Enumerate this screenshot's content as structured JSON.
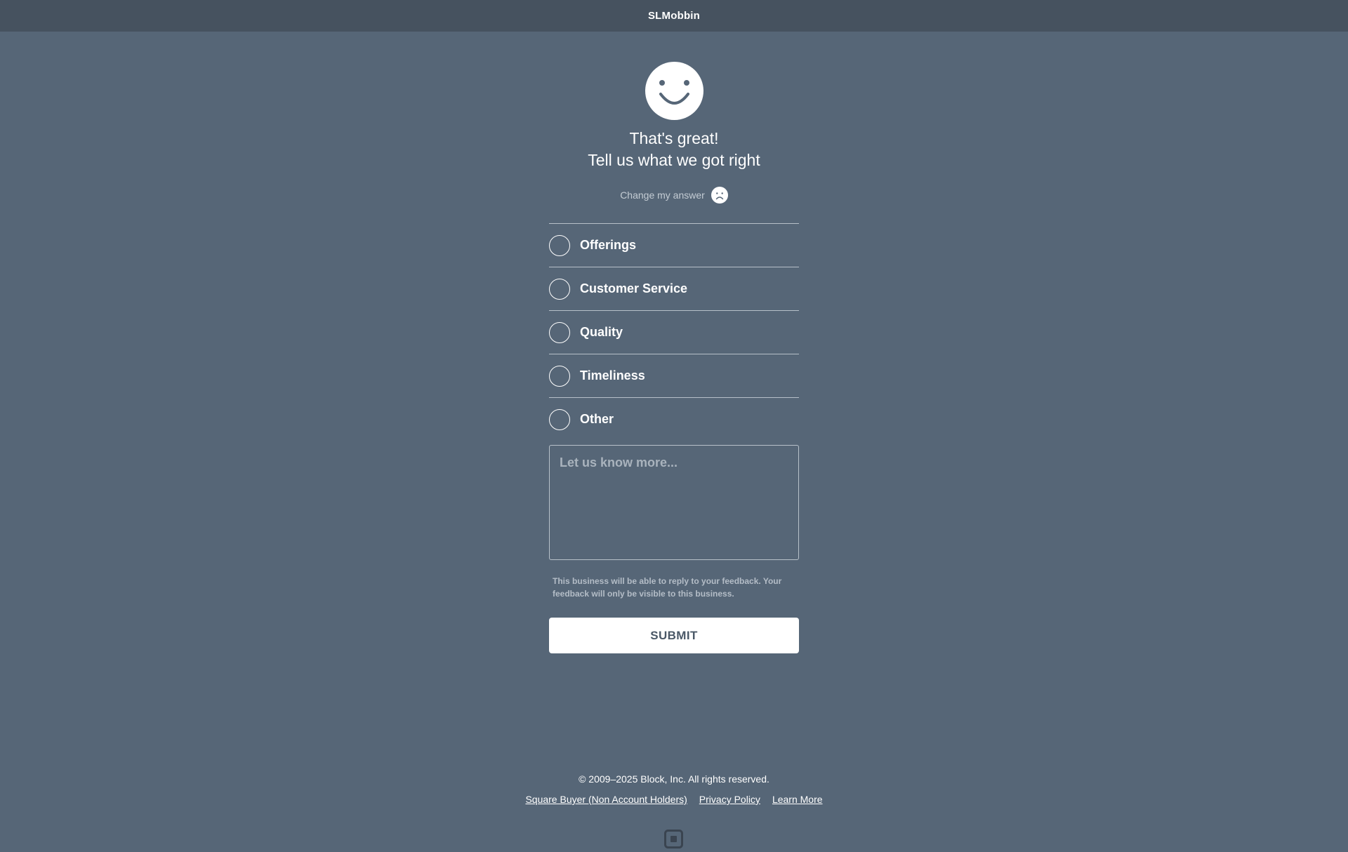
{
  "header": {
    "title": "SLMobbin"
  },
  "hero": {
    "icon": "smiley-face-icon",
    "line1": "That's great!",
    "line2": "Tell us what we got right"
  },
  "change_answer": {
    "label": "Change my answer",
    "icon": "frown-face-icon"
  },
  "options": [
    {
      "label": "Offerings"
    },
    {
      "label": "Customer Service"
    },
    {
      "label": "Quality"
    },
    {
      "label": "Timeliness"
    },
    {
      "label": "Other"
    }
  ],
  "feedback": {
    "placeholder": "Let us know more...",
    "value": ""
  },
  "notice": "This business will be able to reply to your feedback. Your feedback will only be visible to this business.",
  "submit_label": "SUBMIT",
  "footer": {
    "copyright": "© 2009–2025 Block, Inc. All rights reserved.",
    "links": [
      "Square Buyer (Non Account Holders)",
      "Privacy Policy",
      "Learn More"
    ],
    "logo": "square-logo-icon"
  },
  "colors": {
    "background": "#566677",
    "topbar": "#46525f",
    "submit_text": "#4a5867"
  }
}
